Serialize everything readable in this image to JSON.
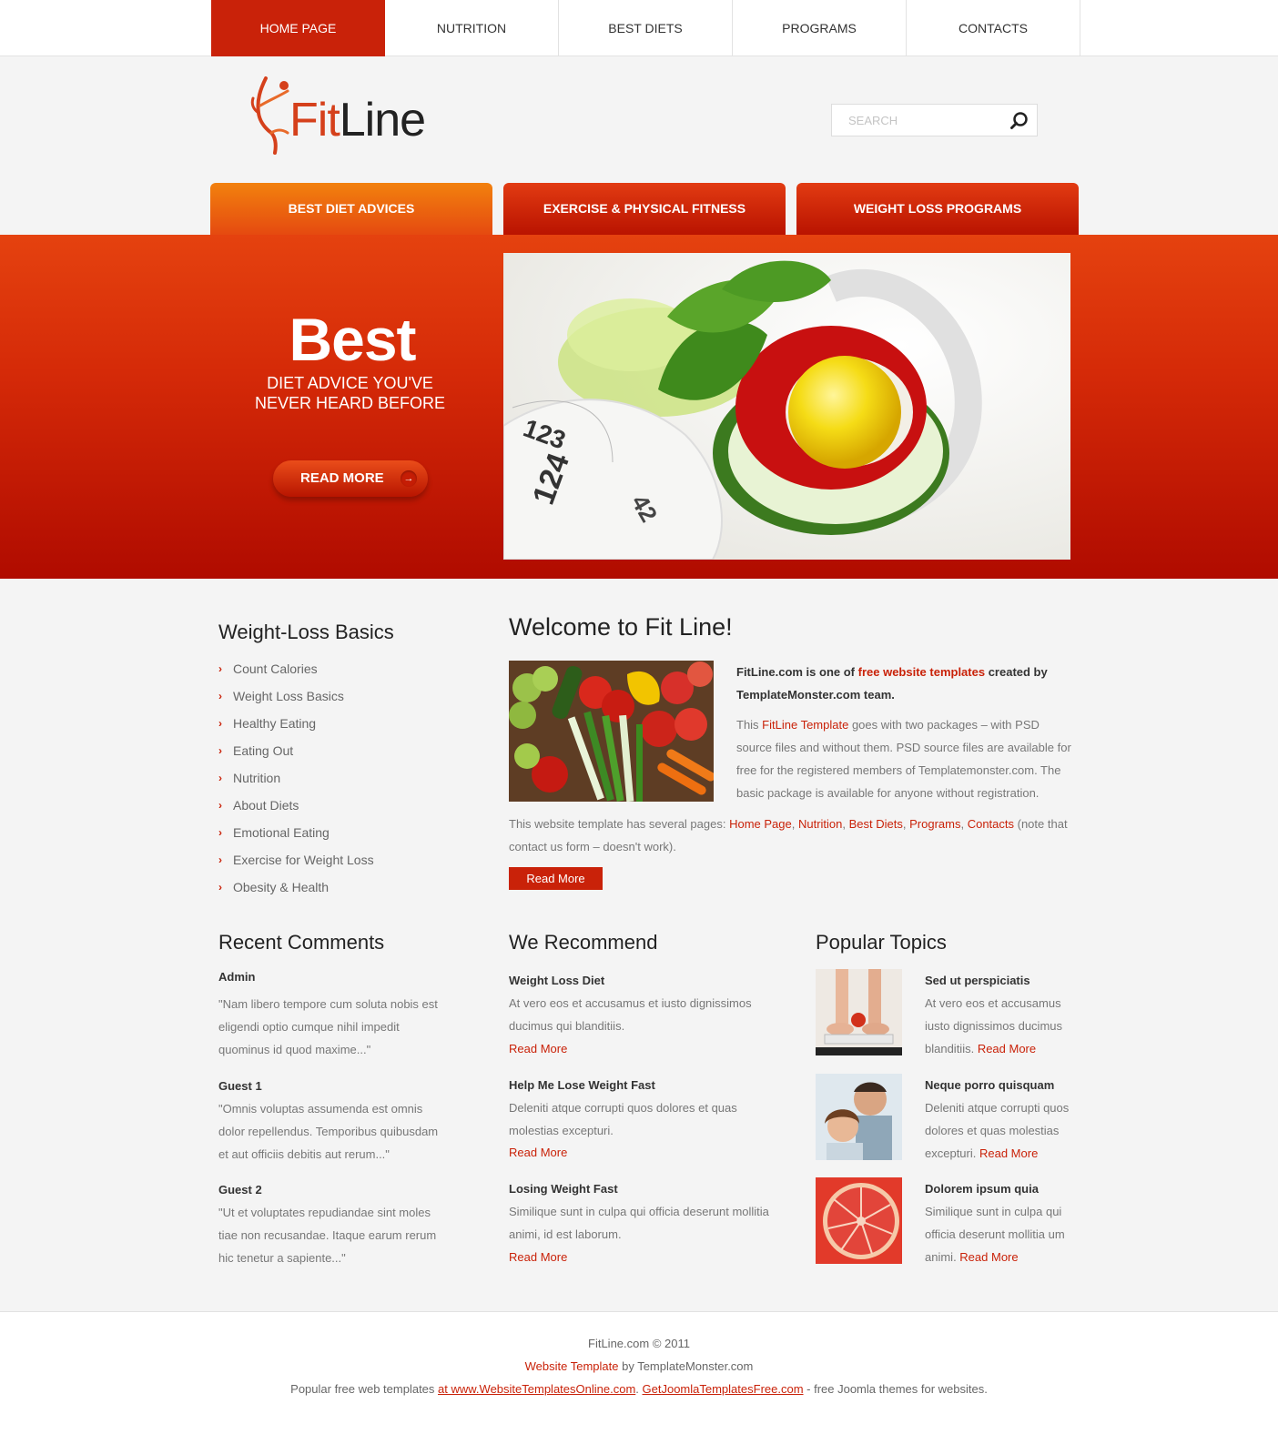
{
  "nav": {
    "items": [
      {
        "label": "HOME PAGE",
        "active": true
      },
      {
        "label": "NUTRITION"
      },
      {
        "label": "BEST DIETS"
      },
      {
        "label": "PROGRAMS"
      },
      {
        "label": "CONTACTS"
      }
    ]
  },
  "header": {
    "logo_fit": "Fit",
    "logo_line": "Line",
    "search_placeholder": "SEARCH"
  },
  "tabs": [
    {
      "label": "BEST DIET ADVICES",
      "active": true
    },
    {
      "label": "EXERCISE & PHYSICAL FITNESS"
    },
    {
      "label": "WEIGHT LOSS PROGRAMS"
    }
  ],
  "banner": {
    "big": "Best",
    "sub_line1": "DIET ADVICE YOU'VE",
    "sub_line2": "NEVER HEARD BEFORE",
    "button": "READ MORE",
    "button_arrow": "→"
  },
  "basics": {
    "title": "Weight-Loss Basics",
    "bullet": "›",
    "items": [
      "Count Calories",
      "Weight Loss Basics",
      "Healthy Eating",
      "Eating Out",
      "Nutrition",
      "About Diets",
      "Emotional Eating",
      "Exercise for Weight Loss",
      "Obesity & Health"
    ]
  },
  "welcome": {
    "title": "Welcome to Fit Line!",
    "p1_a": "FitLine.com is one of ",
    "p1_link": "free website templates",
    "p1_b": " created by TemplateMonster.com team.",
    "p2_a": "This ",
    "p2_link": "FitLine Template",
    "p2_b": " goes with two packages – with PSD source files and without them. PSD source files are available for free for the registered members of Templatemonster.com. The basic package is available for anyone without registration.",
    "p3_a": "This website template has several pages: ",
    "p3_links": [
      "Home Page",
      "Nutrition",
      "Best Diets",
      "Programs",
      "Contacts"
    ],
    "p3_sep": ", ",
    "p3_b": " (note that contact us form – doesn't work).",
    "button": "Read More"
  },
  "comments": {
    "title": "Recent Comments",
    "items": [
      {
        "author": "Admin",
        "text": "\"Nam libero tempore cum soluta nobis est eligendi optio cumque nihil impedit quominus id quod maxime...\""
      },
      {
        "author": "Guest 1",
        "text": "\"Omnis voluptas assumenda est omnis dolor repellendus. Temporibus quibusdam et aut officiis debitis aut rerum...\""
      },
      {
        "author": "Guest 2",
        "text": "\"Ut et voluptates repudiandae sint moles tiae non recusandae. Itaque earum rerum hic tenetur a sapiente...\""
      }
    ]
  },
  "recommend": {
    "title": "We Recommend",
    "items": [
      {
        "title": "Weight Loss Diet",
        "text": "At vero eos et accusamus et iusto dignissimos ducimus qui blanditiis.",
        "link": "Read More"
      },
      {
        "title": "Help Me Lose Weight Fast",
        "text": "Deleniti atque corrupti quos dolores et quas molestias excepturi.",
        "link": "Read More"
      },
      {
        "title": "Losing Weight Fast",
        "text": "Similique sunt in culpa qui officia deserunt mollitia animi, id est laborum.",
        "link": "Read More"
      }
    ]
  },
  "popular": {
    "title": "Popular Topics",
    "items": [
      {
        "title": "Sed ut perspiciatis",
        "text": "At vero eos et accusamus iusto dignissimos ducimus blanditiis. ",
        "link": "Read More"
      },
      {
        "title": "Neque porro quisquam",
        "text": "Deleniti atque corrupti quos dolores et quas molestias excepturi. ",
        "link": "Read More"
      },
      {
        "title": "Dolorem ipsum quia",
        "text": "Similique sunt in culpa qui officia deserunt mollitia um animi. ",
        "link": "Read More"
      }
    ]
  },
  "footer": {
    "copyright": "FitLine.com © 2011",
    "line2_link": "Website Template",
    "line2_rest": " by TemplateMonster.com",
    "line3_a": "Popular free web templates ",
    "line3_link1": "at www.WebsiteTemplatesOnline.com",
    "line3_sep": ". ",
    "line3_link2": "GetJoomlaTemplatesFree.com",
    "line3_b": " - free Joomla themes for websites."
  },
  "colors": {
    "accent": "#c92209",
    "tab_active": "#f2810e",
    "banner_top": "#e5420f",
    "banner_bottom": "#b00b00"
  }
}
